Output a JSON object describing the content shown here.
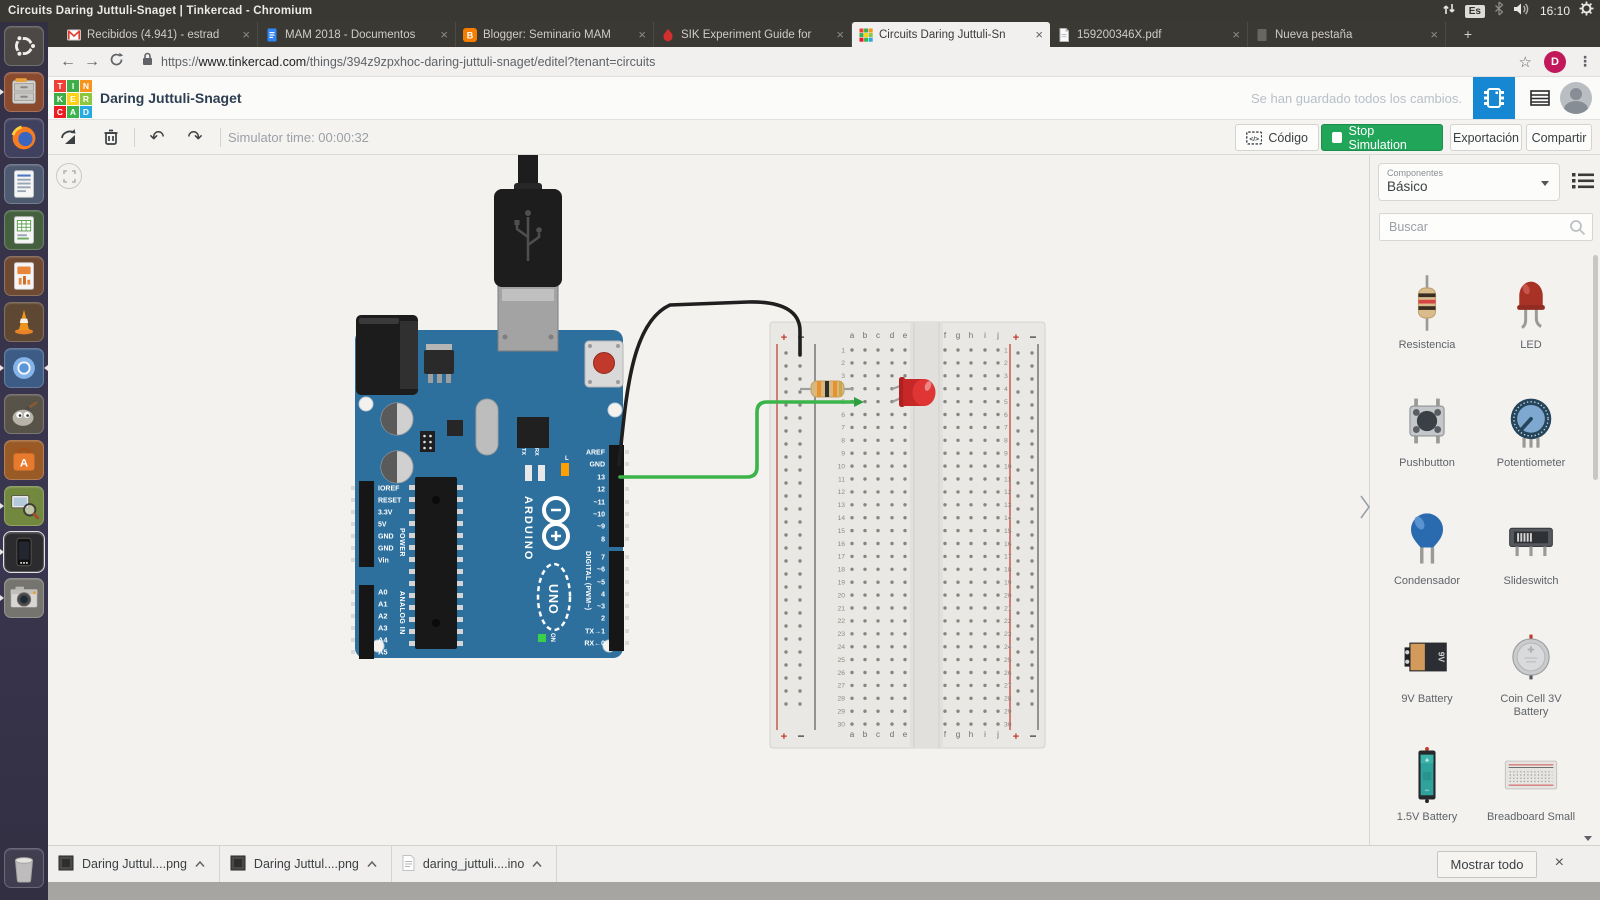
{
  "system_bar": {
    "title": "Circuits Daring Juttuli-Snaget | Tinkercad - Chromium",
    "keyboard_layout": "Es",
    "time": "16:10",
    "tray_icons": [
      "network-arrows-icon",
      "keyboard-layout-badge",
      "bluetooth-icon",
      "volume-icon",
      "clock",
      "session-gear-icon"
    ]
  },
  "launcher": {
    "items": [
      {
        "icon": "ubuntu-dash",
        "running": false
      },
      {
        "icon": "files",
        "running": true
      },
      {
        "icon": "firefox",
        "running": false
      },
      {
        "icon": "libreoffice-writer",
        "running": false
      },
      {
        "icon": "libreoffice-calc",
        "running": false
      },
      {
        "icon": "libreoffice-impress",
        "running": false
      },
      {
        "icon": "vlc",
        "running": false
      },
      {
        "icon": "chromium",
        "running": true,
        "focused": true
      },
      {
        "icon": "gimp",
        "running": false
      },
      {
        "icon": "ubuntu-software",
        "running": false
      },
      {
        "icon": "screenshot-tool",
        "running": true
      },
      {
        "icon": "phone",
        "running": true,
        "selected": true
      },
      {
        "icon": "camera",
        "running": true
      },
      {
        "icon": "trash",
        "running": false
      }
    ]
  },
  "browser": {
    "tabs": [
      {
        "label": "Recibidos (4.941) - estrad",
        "icon": "gmail",
        "active": false
      },
      {
        "label": "MAM 2018 - Documentos",
        "icon": "gdocs",
        "active": false
      },
      {
        "label": "Blogger: Seminario MAM",
        "icon": "blogger",
        "active": false
      },
      {
        "label": "SIK Experiment Guide for",
        "icon": "sik",
        "active": false
      },
      {
        "label": "Circuits Daring Juttuli-Sn",
        "icon": "tinkercad",
        "active": true
      },
      {
        "label": "159200346X.pdf",
        "icon": "pdf",
        "active": false
      },
      {
        "label": "Nueva pestaña",
        "icon": "blank",
        "active": false
      }
    ],
    "new_tab_button": "+",
    "url": {
      "scheme": "https://",
      "host": "www.tinkercad.com",
      "path": "/things/394z9zpxhoc-daring-juttuli-snaget/editel?tenant=circuits"
    },
    "avatar_letter": "D"
  },
  "app_header": {
    "logo_tiles": [
      {
        "l": "T",
        "c": "#ee4036"
      },
      {
        "l": "I",
        "c": "#3fae49"
      },
      {
        "l": "N",
        "c": "#f7941e"
      },
      {
        "l": "K",
        "c": "#3fae49"
      },
      {
        "l": "E",
        "c": "#fcd116"
      },
      {
        "l": "R",
        "c": "#8dc63f"
      },
      {
        "l": "C",
        "c": "#ed1c24"
      },
      {
        "l": "A",
        "c": "#39b54a"
      },
      {
        "l": "D",
        "c": "#27aae1"
      }
    ],
    "title": "Daring Juttuli-Snaget",
    "save_status": "Se han guardado todos los cambios."
  },
  "toolbar": {
    "simulator_time": "Simulator time: 00:00:32",
    "code_label": "Código",
    "stop_label": "Stop Simulation",
    "export_label": "Exportación",
    "share_label": "Compartir"
  },
  "board": {
    "digital_pins": [
      "AREF",
      "GND",
      "13",
      "12",
      "~11",
      "~10",
      "~9",
      "8",
      "7",
      "~6",
      "~5",
      "4",
      "~3",
      "2",
      "TX→1",
      "RX←0"
    ],
    "power_pins": [
      "IOREF",
      "RESET",
      "3.3V",
      "5V",
      "GND",
      "GND",
      "Vin"
    ],
    "analog_pins": [
      "A0",
      "A1",
      "A2",
      "A3",
      "A4",
      "A5"
    ],
    "labels": {
      "digital_group": "DIGITAL (PWM~)",
      "power_group": "POWER",
      "analog_group": "ANALOG IN",
      "brand": "ARDUINO",
      "model": "UNO",
      "tx": "TX",
      "rx": "RX",
      "led_l": "L",
      "led_on": "ON"
    },
    "breadboard": {
      "rows": 30,
      "left_columns": [
        "a",
        "b",
        "c",
        "d",
        "e"
      ],
      "right_columns": [
        "f",
        "g",
        "h",
        "i",
        "j"
      ],
      "plus": "+",
      "minus": "−"
    }
  },
  "sidebar": {
    "category_label": "Componentes",
    "category_value": "Básico",
    "search_placeholder": "Buscar",
    "components": [
      {
        "name": "Resistencia",
        "icon": "resistor"
      },
      {
        "name": "LED",
        "icon": "led"
      },
      {
        "name": "Pushbutton",
        "icon": "pushbutton"
      },
      {
        "name": "Potentiometer",
        "icon": "potentiometer"
      },
      {
        "name": "Condensador",
        "icon": "capacitor"
      },
      {
        "name": "Slideswitch",
        "icon": "slideswitch"
      },
      {
        "name": "9V Battery",
        "icon": "battery9v"
      },
      {
        "name": "Coin Cell 3V Battery",
        "icon": "coincell"
      },
      {
        "name": "1.5V Battery",
        "icon": "battery15v"
      },
      {
        "name": "Breadboard Small",
        "icon": "breadboard"
      }
    ],
    "show_all_label": "Mostrar todo"
  },
  "downloads": {
    "items": [
      {
        "label": "Daring Juttul....png",
        "icon": "image-file"
      },
      {
        "label": "Daring Juttul....png",
        "icon": "image-file"
      },
      {
        "label": "daring_juttuli....ino",
        "icon": "text-file"
      }
    ]
  },
  "colors": {
    "accent_blue": "#1687d3",
    "simulation_green": "#21a659",
    "wire_green": "#3cb44a",
    "wire_black": "#1f1f1f",
    "board_blue": "#2d6f9d"
  }
}
